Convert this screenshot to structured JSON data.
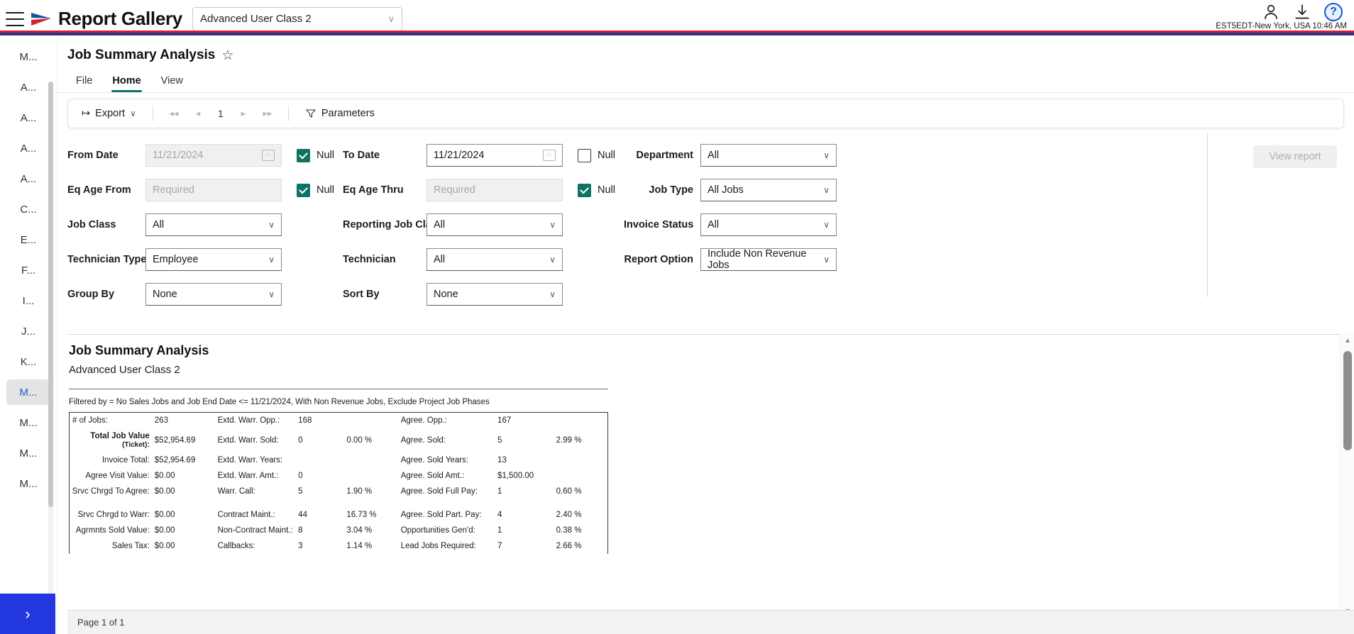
{
  "topbar": {
    "menu_icon": "hamburger-icon",
    "brand": "Report Gallery",
    "user_class_value": "Advanced User Class 2",
    "chevron": "∨",
    "account_icon": "person-icon",
    "download_icon": "download-icon",
    "help_icon": "question-mark-icon",
    "help_label": "?",
    "timezone": "EST5EDT-New York, USA 10:46 AM"
  },
  "sidebar": {
    "items": [
      {
        "label": "M...",
        "active": false
      },
      {
        "label": "A...",
        "active": false
      },
      {
        "label": "A...",
        "active": false
      },
      {
        "label": "A...",
        "active": false
      },
      {
        "label": "A...",
        "active": false
      },
      {
        "label": "C...",
        "active": false
      },
      {
        "label": "E...",
        "active": false
      },
      {
        "label": "F...",
        "active": false
      },
      {
        "label": "I...",
        "active": false
      },
      {
        "label": "J...",
        "active": false
      },
      {
        "label": "K...",
        "active": false
      },
      {
        "label": "M...",
        "active": true
      },
      {
        "label": "M...",
        "active": false
      },
      {
        "label": "M...",
        "active": false
      },
      {
        "label": "M...",
        "active": false
      }
    ],
    "expand_label": "›"
  },
  "header": {
    "title": "Job Summary Analysis",
    "favorite_icon": "☆"
  },
  "ribbon": {
    "tabs": [
      {
        "label": "File",
        "active": false
      },
      {
        "label": "Home",
        "active": true
      },
      {
        "label": "View",
        "active": false
      }
    ]
  },
  "toolbar": {
    "export_label": "Export",
    "export_icon": "↦",
    "export_chevron": "∨",
    "first_page_icon": "⏪",
    "prev_page_icon": "◁",
    "page_number": "1",
    "next_page_icon": "▷",
    "last_page_icon": "⏩",
    "parameters_label": "Parameters",
    "parameters_icon": "filter-funnel-icon"
  },
  "parameters": {
    "null_label": "Null",
    "view_report_label": "View report",
    "rows": [
      {
        "c1_label": "From Date",
        "c1_value": "11/21/2024",
        "c1_type": "date",
        "c1_disabled": true,
        "c1_null": true,
        "c2_label": "To Date",
        "c2_value": "11/21/2024",
        "c2_type": "date",
        "c2_disabled": false,
        "c2_null": false,
        "c3_label": "Department",
        "c3_value": "All",
        "c3_type": "select"
      },
      {
        "c1_label": "Eq Age From",
        "c1_value": "Required",
        "c1_type": "text",
        "c1_disabled": true,
        "c1_null": true,
        "c2_label": "Eq Age Thru",
        "c2_value": "Required",
        "c2_type": "text",
        "c2_disabled": true,
        "c2_null": true,
        "c3_label": "Job Type",
        "c3_value": "All Jobs",
        "c3_type": "select"
      },
      {
        "c1_label": "Job Class",
        "c1_value": "All",
        "c1_type": "select",
        "c1_disabled": false,
        "c1_null": null,
        "c2_label": "Reporting Job Class",
        "c2_value": "All",
        "c2_type": "select",
        "c2_disabled": false,
        "c2_null": null,
        "c3_label": "Invoice Status",
        "c3_value": "All",
        "c3_type": "select"
      },
      {
        "c1_label": "Technician Type",
        "c1_value": "Employee",
        "c1_type": "select",
        "c1_disabled": false,
        "c1_null": null,
        "c2_label": "Technician",
        "c2_value": "All",
        "c2_type": "select",
        "c2_disabled": false,
        "c2_null": null,
        "c3_label": "Report Option",
        "c3_value": "Include Non Revenue Jobs",
        "c3_type": "select"
      },
      {
        "c1_label": "Group By",
        "c1_value": "None",
        "c1_type": "select",
        "c1_disabled": false,
        "c1_null": null,
        "c2_label": "Sort By",
        "c2_value": "None",
        "c2_type": "select",
        "c2_disabled": false,
        "c2_null": null,
        "c3_label": "",
        "c3_value": "",
        "c3_type": "none"
      }
    ]
  },
  "report": {
    "title": "Job Summary Analysis",
    "subtitle": "Advanced User Class 2",
    "filter_text": "Filtered by = No Sales Jobs and Job End Date <= 11/21/2024, With Non Revenue Jobs, Exclude Project Job Phases",
    "rows": [
      {
        "l1": "# of Jobs:",
        "l1_align": "left",
        "l1_bold": false,
        "v1": "263",
        "l2": "Extd. Warr. Opp.:",
        "v2": "168",
        "p2": "",
        "l3": "Agree. Opp.:",
        "v3": "167",
        "p3": ""
      },
      {
        "l1": "Total Job Value (Ticket):",
        "l1_align": "right",
        "l1_bold": true,
        "v1": "$52,954.69",
        "l2": "Extd. Warr. Sold:",
        "v2": "0",
        "p2": "0.00 %",
        "l3": "Agree. Sold:",
        "v3": "5",
        "p3": "2.99 %"
      },
      {
        "l1": "Invoice Total:",
        "l1_align": "right",
        "l1_bold": false,
        "v1": "$52,954.69",
        "l2": "Extd. Warr. Years:",
        "v2": "",
        "p2": "",
        "l3": "Agree. Sold Years:",
        "v3": "13",
        "p3": ""
      },
      {
        "l1": "Agree Visit Value:",
        "l1_align": "right",
        "l1_bold": false,
        "v1": "$0.00",
        "l2": "Extd. Warr. Amt.:",
        "v2": "0",
        "p2": "",
        "l3": "Agree. Sold Amt.:",
        "v3": "$1,500.00",
        "p3": ""
      },
      {
        "l1": "Srvc Chrgd To Agree:",
        "l1_align": "right",
        "l1_bold": false,
        "v1": "$0.00",
        "l2": "Warr. Call:",
        "v2": "5",
        "p2": "1.90 %",
        "l3": "Agree. Sold Full Pay:",
        "v3": "1",
        "p3": "0.60 %"
      },
      {
        "gap": true
      },
      {
        "l1": "Srvc Chrgd to Warr:",
        "l1_align": "right",
        "l1_bold": false,
        "v1": "$0.00",
        "l2": "Contract Maint.:",
        "v2": "44",
        "p2": "16.73 %",
        "l3": "Agree. Sold Part. Pay:",
        "v3": "4",
        "p3": "2.40 %"
      },
      {
        "l1": "Agrmnts Sold Value:",
        "l1_align": "right",
        "l1_bold": false,
        "v1": "$0.00",
        "l2": "Non-Contract Maint.:",
        "v2": "8",
        "p2": "3.04 %",
        "l3": "Opportunities Gen'd:",
        "v3": "1",
        "p3": "0.38 %"
      },
      {
        "l1": "Sales Tax:",
        "l1_align": "right",
        "l1_bold": false,
        "v1": "$0.00",
        "l2": "Callbacks:",
        "v2": "3",
        "p2": "1.14 %",
        "l3": "Lead Jobs Required:",
        "v3": "7",
        "p3": "2.66 %"
      }
    ]
  },
  "statusbar": {
    "page_info": "Page 1 of 1"
  },
  "colors": {
    "brand_red": "#d5212f",
    "brand_blue": "#27348b",
    "accent_teal": "#107569",
    "checkbox_green": "#0f7364",
    "expand_blue": "#2438e0",
    "link_blue": "#1558d6"
  }
}
